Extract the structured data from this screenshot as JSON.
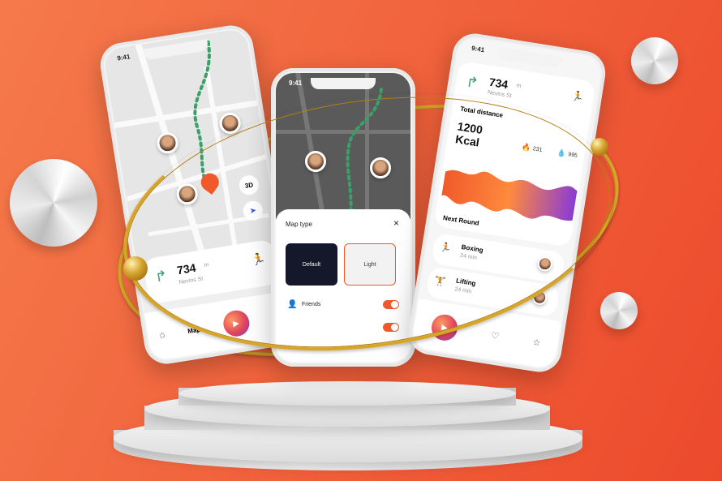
{
  "left_phone": {
    "time": "9:41",
    "badge_3d": "3D",
    "distance_value": "734",
    "distance_unit": "m",
    "street": "Nevins St",
    "nav_map": "Map"
  },
  "middle_phone": {
    "time": "9:41",
    "sheet_title": "Map type",
    "close": "×",
    "option_default": "Default",
    "option_light": "Light",
    "friends_label": "Friends"
  },
  "right_phone": {
    "time": "9:41",
    "distance_value": "734",
    "distance_unit": "m",
    "street": "Nevins St",
    "total_distance_label": "Total distance",
    "kcal_value": "1200",
    "kcal_unit": "Kcal",
    "stat_fire": "231",
    "stat_drop": "995",
    "next_round_label": "Next Round",
    "rounds": [
      {
        "name": "Boxing",
        "duration": "24 min"
      },
      {
        "name": "Lifting",
        "duration": "24 min"
      }
    ]
  },
  "colors": {
    "accent": "#f05a2a",
    "background": "#f1643d",
    "gold": "#d7a52a"
  }
}
